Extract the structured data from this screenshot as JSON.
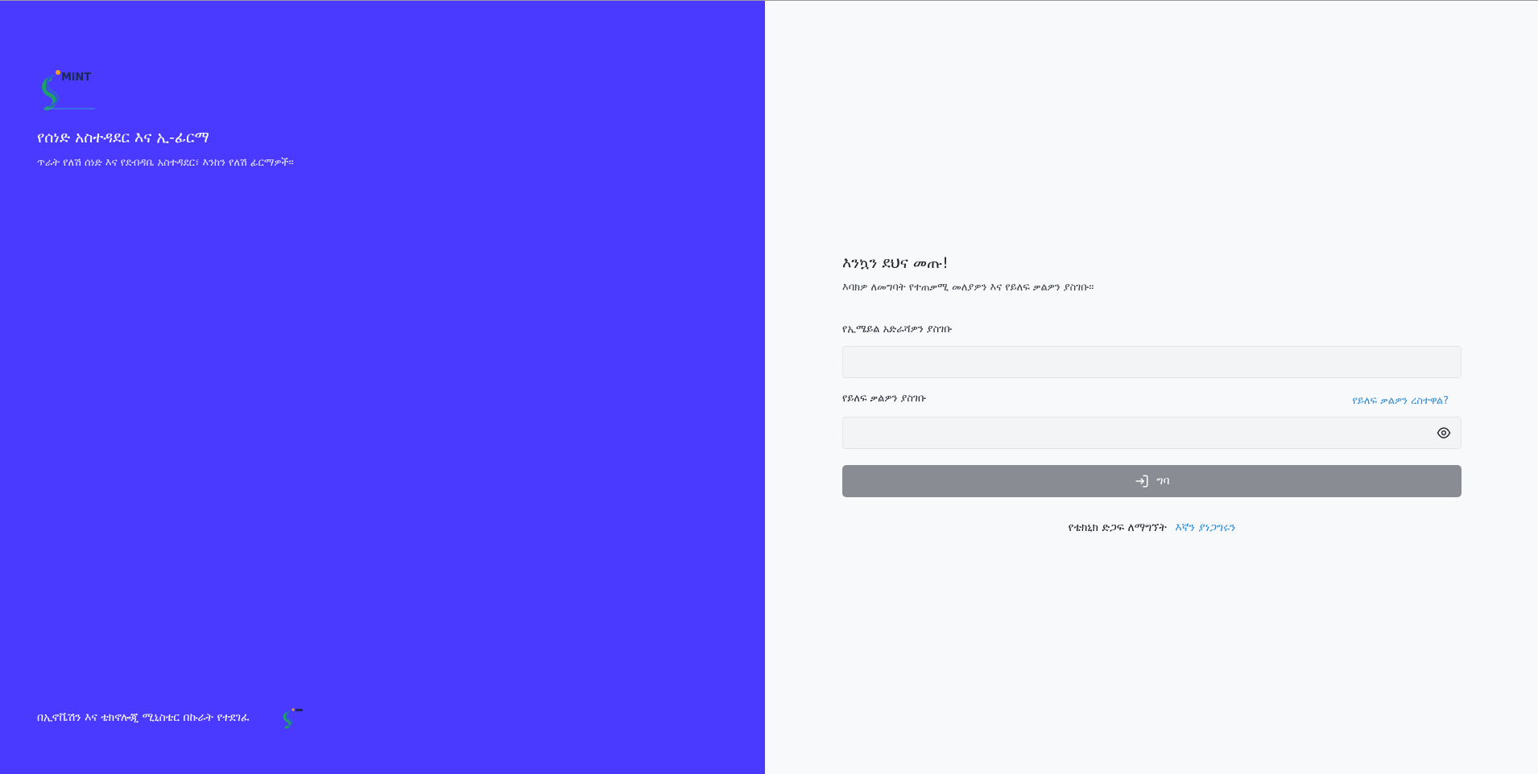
{
  "brand": {
    "title": "የሰነድ አስተዳደር እና ኢ-ፊርማ",
    "subtitle": "ጥራት የለሽ ሰነድ እና የደብዳቤ አስተዳደር፣ እንከን የለሽ ፊርማዎች።",
    "logo_text": "MiNT",
    "footer": "በኢኖቬሽን እና ቴክኖሎጂ ሚኒስቴር በኩራት የተደገፈ"
  },
  "form": {
    "welcome": "እንኳን ደህና መጡ!",
    "instructions": "እባክዎ ለመግባት የተጠቃሚ መለያዎን እና የይለፍ ቃልዎን ያስገቡ።",
    "email_label": "የኢሜይል አድራሻዎን ያስገቡ",
    "email_value": "",
    "password_label": "የይለፍ ቃልዎን ያስገቡ",
    "password_value": "",
    "forgot_password": "የይለፍ ቃልዎን ረስተዋል?",
    "login_label": "ግባ"
  },
  "support": {
    "text": "የቴክኒክ ድጋፍ ለማግኘት",
    "link": "እኛን ያነጋግሩን"
  },
  "colors": {
    "left_panel": "#4a3aff",
    "right_panel": "#f8f9fb",
    "button_disabled": "#898c92",
    "link": "#2f8fd9"
  },
  "icons": [
    "mint-logo",
    "eye-icon",
    "login-icon"
  ]
}
